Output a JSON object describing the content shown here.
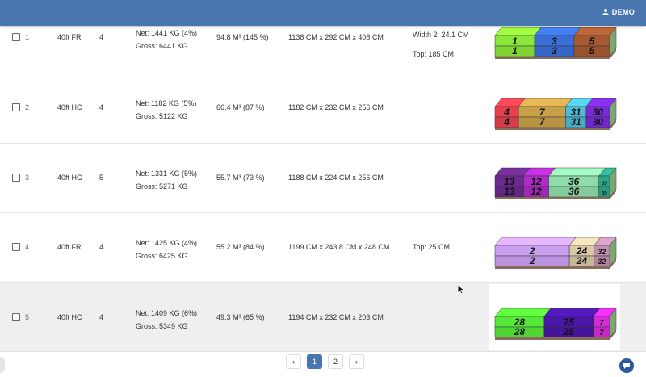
{
  "header": {
    "user_label": "DEMO",
    "color": "#4a76b0"
  },
  "rows": [
    {
      "num": "1",
      "type": "40ft FR",
      "count": "4",
      "net": "Net: 1441 KG (4%)",
      "gross": "Gross: 6441 KG",
      "volume": "94.8 M³ (145 %)",
      "dims": "1138 CM x 292 CM x 408 CM",
      "extra1": "Width 2: 24.1 CM",
      "extra2": "Top: 185 CM",
      "blocks": [
        {
          "label": "1",
          "w": 1,
          "color": "#8be83a"
        },
        {
          "label": "3",
          "w": 1,
          "color": "#3a6fd8"
        },
        {
          "label": "5",
          "w": 0.9,
          "color": "#a65a32"
        }
      ]
    },
    {
      "num": "2",
      "type": "40ft HC",
      "count": "4",
      "net": "Net: 1182 KG (5%)",
      "gross": "Gross: 5122 KG",
      "volume": "66.4 M³ (87 %)",
      "dims": "1182 CM x 232 CM x 256 CM",
      "extra1": "",
      "extra2": "",
      "blocks": [
        {
          "label": "4",
          "w": 0.8,
          "color": "#e8404e"
        },
        {
          "label": "7",
          "w": 1.6,
          "color": "#c9a04a"
        },
        {
          "label": "31",
          "w": 0.7,
          "color": "#4dbcd6"
        },
        {
          "label": "30",
          "w": 0.8,
          "color": "#7a2ad8"
        }
      ]
    },
    {
      "num": "3",
      "type": "40ft HC",
      "count": "5",
      "net": "Net: 1331 KG (5%)",
      "gross": "Gross: 5271 KG",
      "volume": "55.7 M³ (73 %)",
      "dims": "1188 CM x 224 CM x 256 CM",
      "extra1": "",
      "extra2": "",
      "blocks": [
        {
          "label": "13",
          "w": 0.8,
          "color": "#6a2a8e"
        },
        {
          "label": "12",
          "w": 0.7,
          "color": "#b02ac8"
        },
        {
          "label": "36",
          "w": 1.4,
          "color": "#8edcaa"
        },
        {
          "label": "35",
          "w": 0.3,
          "color": "#2aa88a"
        }
      ]
    },
    {
      "num": "4",
      "type": "40ft FR",
      "count": "4",
      "net": "Net: 1425 KG (4%)",
      "gross": "Gross: 6425 KG",
      "volume": "55.2 M³ (84 %)",
      "dims": "1199 CM x 243.8 CM x 248 CM",
      "extra1": "Top: 25 CM",
      "extra2": "",
      "blocks": [
        {
          "label": "2",
          "w": 2.4,
          "color": "#c9a0f0"
        },
        {
          "label": "24",
          "w": 0.8,
          "color": "#d8c8a8"
        },
        {
          "label": "32",
          "w": 0.5,
          "color": "#c090b0"
        }
      ]
    },
    {
      "num": "5",
      "type": "40ft HC",
      "count": "4",
      "net": "Net: 1409 KG (6%)",
      "gross": "Gross: 5349 KG",
      "volume": "49.3 M³ (65 %)",
      "dims": "1194 CM x 232 CM x 203 CM",
      "extra1": "",
      "extra2": "",
      "blocks": [
        {
          "label": "28",
          "w": 1.2,
          "color": "#55e838"
        },
        {
          "label": "25",
          "w": 1.2,
          "color": "#4a16a8"
        },
        {
          "label": "7",
          "w": 0.4,
          "color": "#d82ad8"
        }
      ]
    }
  ],
  "pagination": {
    "prev": "‹",
    "pages": [
      "1",
      "2"
    ],
    "current": "1",
    "next": "›"
  }
}
